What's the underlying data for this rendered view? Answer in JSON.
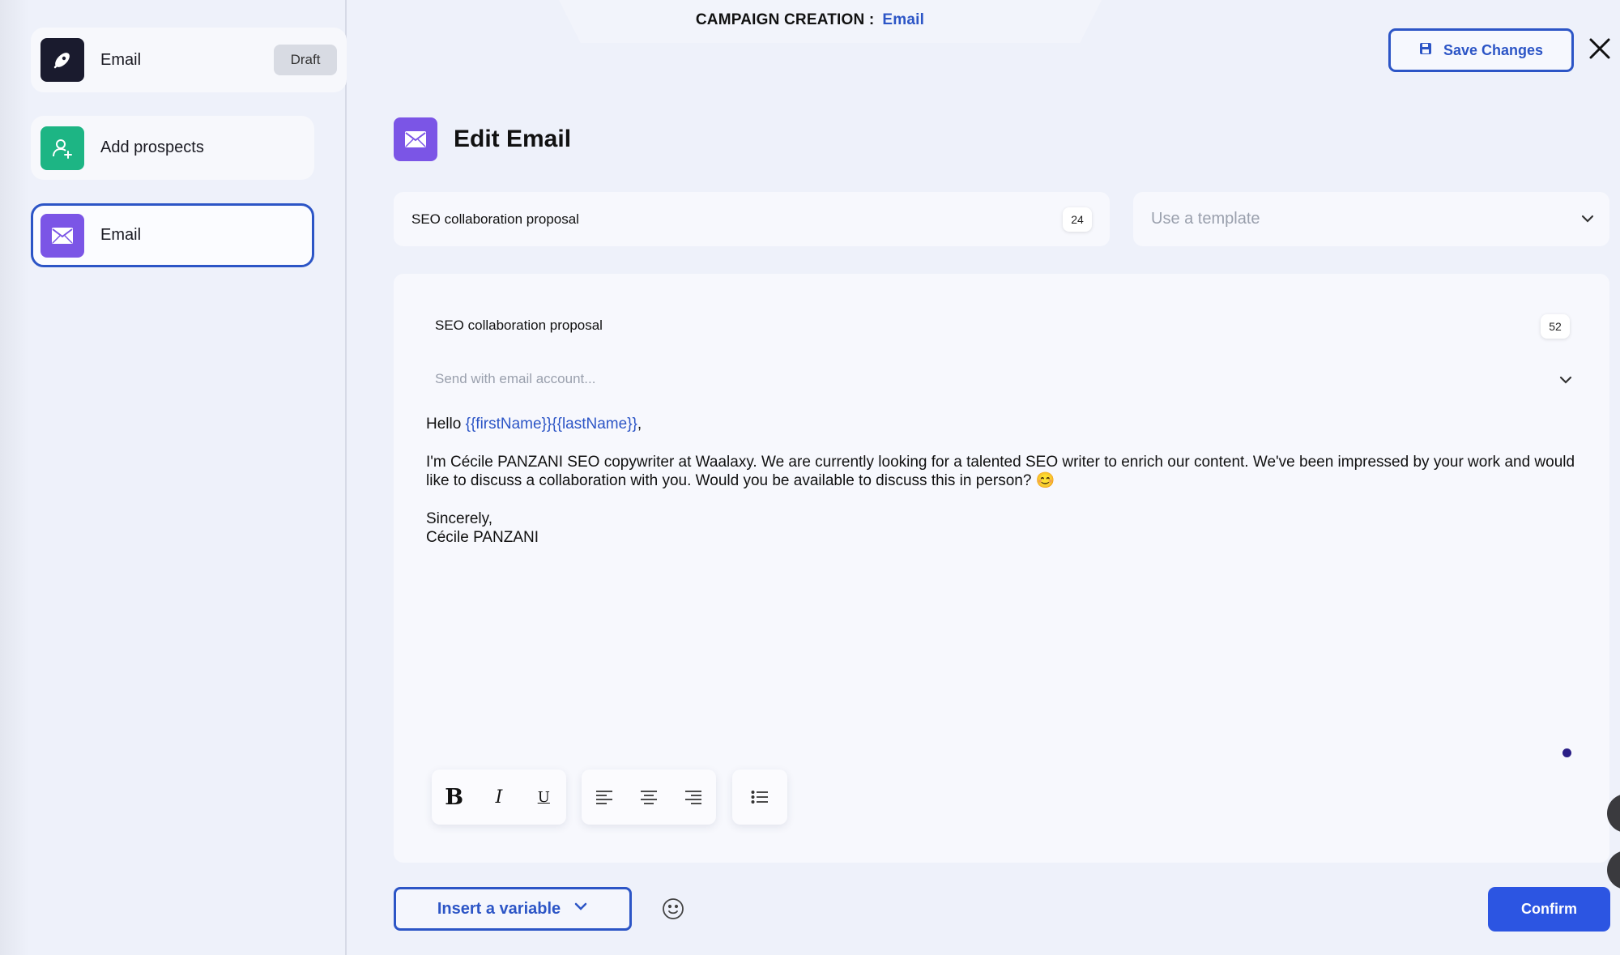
{
  "header": {
    "label": "CAMPAIGN CREATION :",
    "value": "Email"
  },
  "toolbar": {
    "save_label": "Save Changes"
  },
  "sidebar": {
    "campaign": {
      "label": "Email",
      "badge": "Draft"
    },
    "steps": [
      {
        "label": "Add prospects"
      },
      {
        "label": "Email"
      }
    ]
  },
  "main": {
    "title": "Edit Email",
    "subject": {
      "value": "SEO collaboration proposal",
      "count": "24"
    },
    "template": {
      "placeholder": "Use a template"
    },
    "editor": {
      "subject": "SEO collaboration proposal",
      "subject_count": "52",
      "account_placeholder": "Send with email account...",
      "greeting": "Hello",
      "var_first": "{{firstName}}",
      "var_last": "{{lastName}}",
      "comma": ",",
      "paragraph": "I'm Cécile PANZANI SEO copywriter at Waalaxy. We are currently looking for a talented SEO writer to enrich our content. We've been impressed by your work and would like to discuss a collaboration with you. Would you be available to discuss this in person? 😊",
      "closing": "Sincerely,",
      "signature": "Cécile PANZANI"
    },
    "formatting": {
      "bold": "B",
      "italic": "I",
      "underline": "U"
    },
    "insert_variable_label": "Insert a variable",
    "confirm_label": "Confirm"
  },
  "colors": {
    "accent": "#2c55c6",
    "confirm": "#2c55e2",
    "email_icon_bg": "#7b55e6",
    "prospects_icon_bg": "#1db584",
    "campaign_icon_bg": "#1a1b2e"
  },
  "icons": [
    "rocket-icon",
    "user-plus-icon",
    "mail-icon",
    "save-icon",
    "close-icon",
    "chevron-down-icon",
    "align-left-icon",
    "align-center-icon",
    "align-right-icon",
    "bullet-list-icon",
    "emoji-icon"
  ]
}
